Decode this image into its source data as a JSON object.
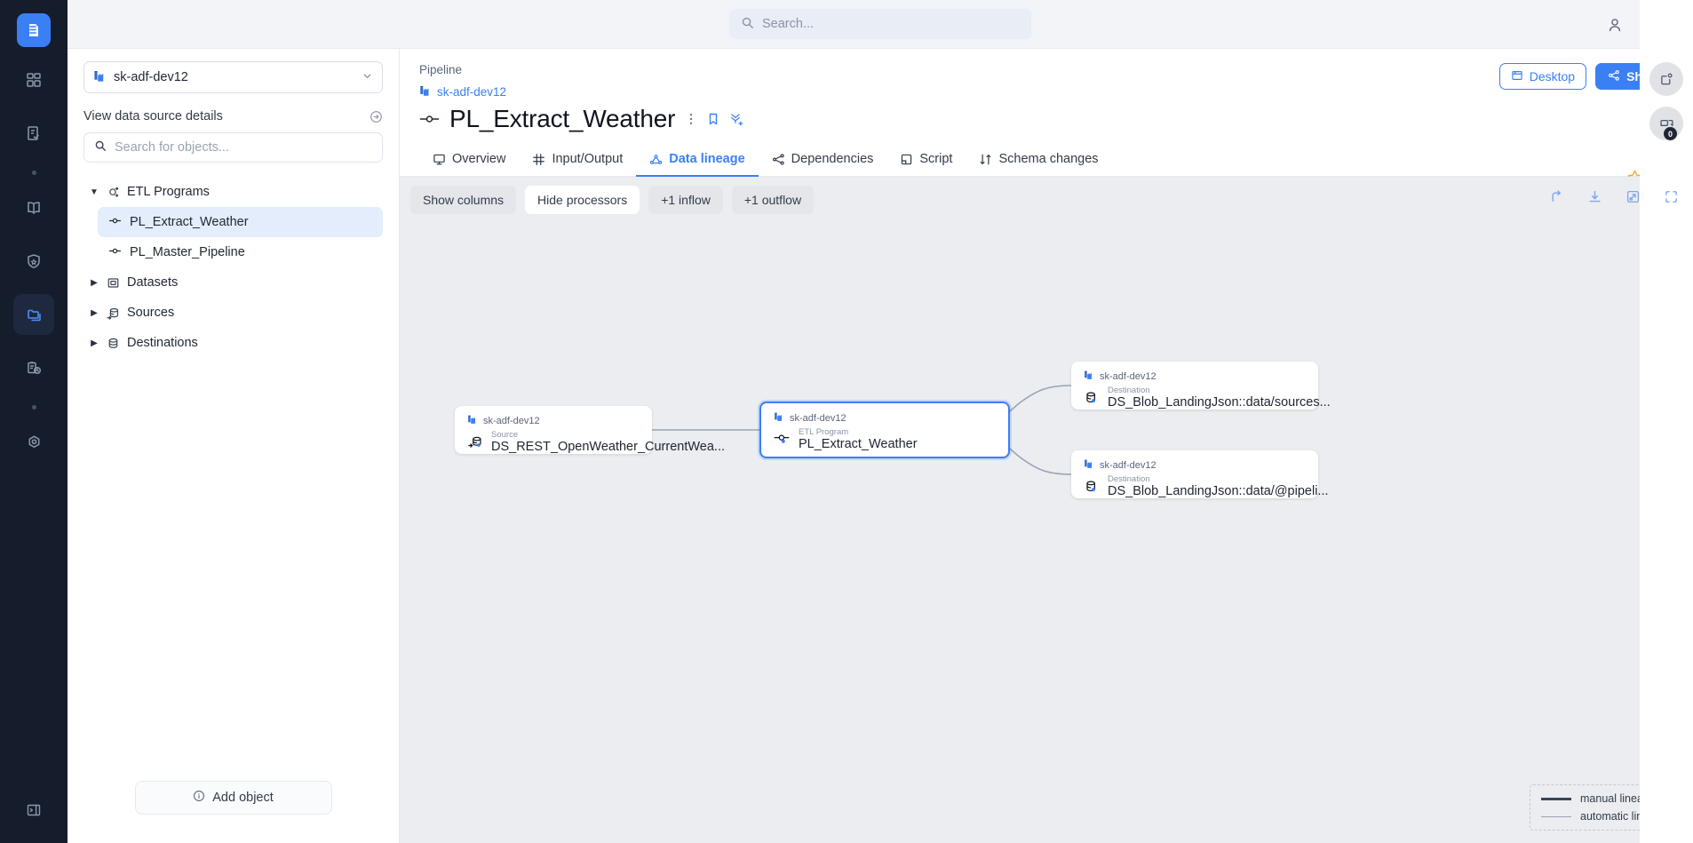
{
  "rail": {
    "logo": "datahub-logo",
    "items": [
      {
        "name": "dashboard-icon"
      },
      {
        "name": "tasks-icon"
      },
      {
        "name": "dot-separator"
      },
      {
        "name": "glossary-book-icon"
      },
      {
        "name": "shield-star-icon"
      },
      {
        "name": "catalog-folders-icon",
        "active": true
      },
      {
        "name": "clipboard-clock-icon"
      },
      {
        "name": "dot-separator"
      },
      {
        "name": "hexagon-settings-icon"
      }
    ],
    "bottom": "collapse-panel-icon"
  },
  "topbar": {
    "search_placeholder": "Search...",
    "search_value": "",
    "user_icon": "user-avatar-icon"
  },
  "sidebar": {
    "datasource": "sk-adf-dev12",
    "view_details_label": "View data source details",
    "search_placeholder": "Search for objects...",
    "search_value": "",
    "tree": [
      {
        "label": "ETL Programs",
        "expanded": true,
        "icon": "etl-programs-icon",
        "children": [
          {
            "label": "PL_Extract_Weather",
            "selected": true
          },
          {
            "label": "PL_Master_Pipeline",
            "selected": false
          }
        ]
      },
      {
        "label": "Datasets",
        "expanded": false,
        "icon": "datasets-icon",
        "children": []
      },
      {
        "label": "Sources",
        "expanded": false,
        "icon": "sources-icon",
        "children": []
      },
      {
        "label": "Destinations",
        "expanded": false,
        "icon": "destinations-icon",
        "children": []
      }
    ],
    "add_object_label": "Add object"
  },
  "page": {
    "breadcrumb_type": "Pipeline",
    "breadcrumb_source": "sk-adf-dev12",
    "title": "PL_Extract_Weather",
    "desktop_label": "Desktop",
    "share_label": "Share",
    "tabs": [
      {
        "label": "Overview",
        "icon": "overview-icon",
        "active": false
      },
      {
        "label": "Input/Output",
        "icon": "input-output-icon",
        "active": false
      },
      {
        "label": "Data lineage",
        "icon": "data-lineage-icon",
        "active": true
      },
      {
        "label": "Dependencies",
        "icon": "dependencies-icon",
        "active": false
      },
      {
        "label": "Script",
        "icon": "script-icon",
        "active": false
      },
      {
        "label": "Schema changes",
        "icon": "schema-changes-icon",
        "active": false
      }
    ]
  },
  "graph": {
    "toolbar": [
      {
        "label": "Show columns",
        "style": "gray"
      },
      {
        "label": "Hide processors",
        "style": "white"
      },
      {
        "label": "+1 inflow",
        "style": "gray"
      },
      {
        "label": "+1 outflow",
        "style": "gray"
      }
    ],
    "tools_right": [
      "share-arrow-icon",
      "download-icon",
      "expand-popout-icon",
      "fullscreen-icon"
    ],
    "nodes": [
      {
        "source": "sk-adf-dev12",
        "kind": "Source",
        "name": "DS_REST_OpenWeather_CurrentWea...",
        "icon": "source-db-icon",
        "selected": false
      },
      {
        "source": "sk-adf-dev12",
        "kind": "ETL Program",
        "name": "PL_Extract_Weather",
        "icon": "etl-program-icon",
        "selected": true
      },
      {
        "source": "sk-adf-dev12",
        "kind": "Destination",
        "name": "DS_Blob_LandingJson::data/sources...",
        "icon": "destination-db-icon",
        "selected": false
      },
      {
        "source": "sk-adf-dev12",
        "kind": "Destination",
        "name": "DS_Blob_LandingJson::data/@pipeli...",
        "icon": "destination-db-icon",
        "selected": false
      }
    ],
    "legend": [
      {
        "label": "manual lineage",
        "style": "manual"
      },
      {
        "label": "automatic lineage",
        "style": "automatic"
      }
    ]
  },
  "right_rail": {
    "buttons": [
      {
        "name": "new-window-icon",
        "badge": null
      },
      {
        "name": "comments-icon",
        "badge": "0"
      }
    ]
  },
  "colors": {
    "accent": "#3b7ff5",
    "rail_bg": "#151c2c",
    "canvas_bg": "#ebedf0",
    "star": "#f0a92b"
  }
}
